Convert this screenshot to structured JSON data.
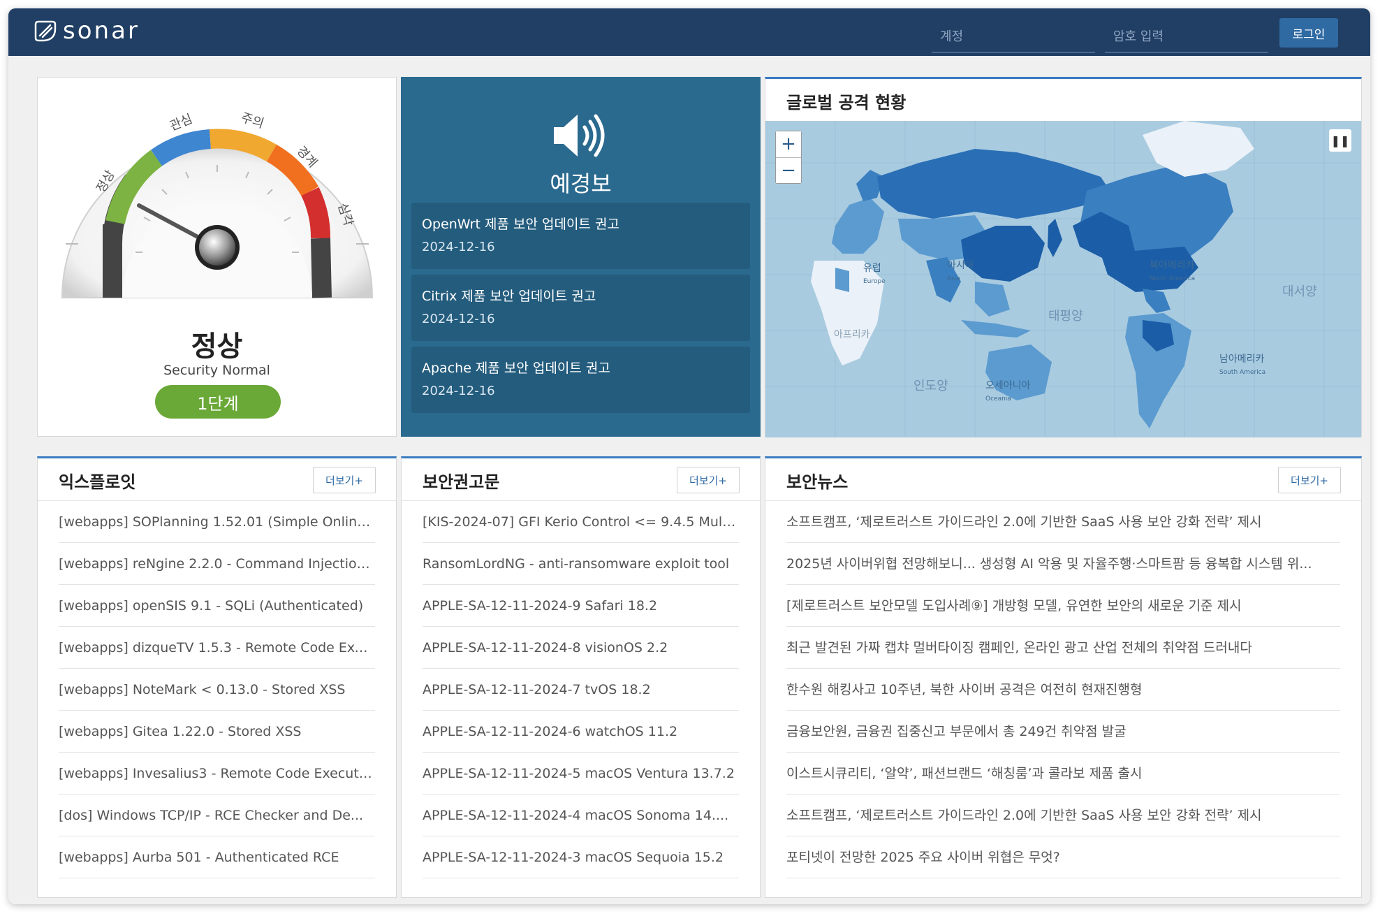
{
  "header": {
    "logo_text": "sonar",
    "account_placeholder": "계정",
    "password_placeholder": "암호 입력",
    "login_label": "로그인"
  },
  "gauge": {
    "labels": [
      "정상",
      "관심",
      "주의",
      "경계",
      "심각"
    ],
    "status_title": "정상",
    "status_sub": "Security Normal",
    "level_label": "1단계",
    "colors": {
      "normal": "#7cb342",
      "interest": "#3f86d1",
      "caution": "#f0a830",
      "alert": "#f07020",
      "severe": "#d32f2f"
    }
  },
  "alerts": {
    "title": "예경보",
    "items": [
      {
        "title": "OpenWrt 제품 보안 업데이트 권고",
        "date": "2024-12-16"
      },
      {
        "title": "Citrix 제품 보안 업데이트 권고",
        "date": "2024-12-16"
      },
      {
        "title": "Apache 제품 보안 업데이트 권고",
        "date": "2024-12-16"
      }
    ]
  },
  "map": {
    "title": "글로벌 공격 현황",
    "zoom_in": "+",
    "zoom_out": "−",
    "pause": "❚❚",
    "region_labels": [
      {
        "ko": "유럽",
        "en": "Europe"
      },
      {
        "ko": "아시아",
        "en": "Asia"
      },
      {
        "ko": "북아메리카",
        "en": "North America"
      },
      {
        "ko": "대서양",
        "en": ""
      },
      {
        "ko": "태평양",
        "en": ""
      },
      {
        "ko": "아프리카",
        "en": ""
      },
      {
        "ko": "남아메리카",
        "en": "South America"
      },
      {
        "ko": "인도양",
        "en": ""
      },
      {
        "ko": "오세아니아",
        "en": "Oceania"
      }
    ]
  },
  "exploit": {
    "title": "익스플로잇",
    "more": "더보기+",
    "items": [
      "[webapps] SOPlanning 1.52.01 (Simple Online...",
      "[webapps] reNgine 2.2.0 - Command Injection...",
      "[webapps] openSIS 9.1 - SQLi (Authenticated)",
      "[webapps] dizqueTV 1.5.3 - Remote Code Exe...",
      "[webapps] NoteMark < 0.13.0 - Stored XSS",
      "[webapps] Gitea 1.22.0 - Stored XSS",
      "[webapps] Invesalius3 - Remote Code Executi...",
      "[dos] Windows TCP/IP - RCE Checker and De...",
      "[webapps] Aurba 501 - Authenticated RCE"
    ]
  },
  "advisory": {
    "title": "보안권고문",
    "more": "더보기+",
    "items": [
      "[KIS-2024-07] GFI Kerio Control <= 9.4.5 Multi...",
      "RansomLordNG - anti-ransomware exploit tool",
      "APPLE-SA-12-11-2024-9 Safari 18.2",
      "APPLE-SA-12-11-2024-8 visionOS 2.2",
      "APPLE-SA-12-11-2024-7 tvOS 18.2",
      "APPLE-SA-12-11-2024-6 watchOS 11.2",
      "APPLE-SA-12-11-2024-5 macOS Ventura 13.7.2",
      "APPLE-SA-12-11-2024-4 macOS Sonoma 14....",
      "APPLE-SA-12-11-2024-3 macOS Sequoia 15.2"
    ]
  },
  "news": {
    "title": "보안뉴스",
    "more": "더보기+",
    "items": [
      "소프트캠프, ‘제로트러스트 가이드라인 2.0에 기반한 SaaS 사용 보안 강화 전략’ 제시",
      "2025년 사이버위협 전망해보니... 생성형 AI 악용 및 자율주행·스마트팜 등 융복합 시스템 위...",
      "[제로트러스트 보안모델 도입사례⑨] 개방형 모델, 유연한 보안의 새로운 기준 제시",
      "최근 발견된 가짜 캡챠 멀버타이징 캠페인, 온라인 광고 산업 전체의 취약점 드러내다",
      "한수원 해킹사고 10주년, 북한 사이버 공격은 여전히 현재진행형",
      "금융보안원, 금융권 집중신고 부문에서 총 249건 취약점 발굴",
      "이스트시큐리티, ‘알약’, 패션브랜드 ‘해칭룸’과 콜라보 제품 출시",
      "소프트캠프, ‘제로트러스트 가이드라인 2.0에 기반한 SaaS 사용 보안 강화 전략’ 제시",
      "포티넷이 전망한 2025 주요 사이버 위협은 무엇?"
    ]
  }
}
